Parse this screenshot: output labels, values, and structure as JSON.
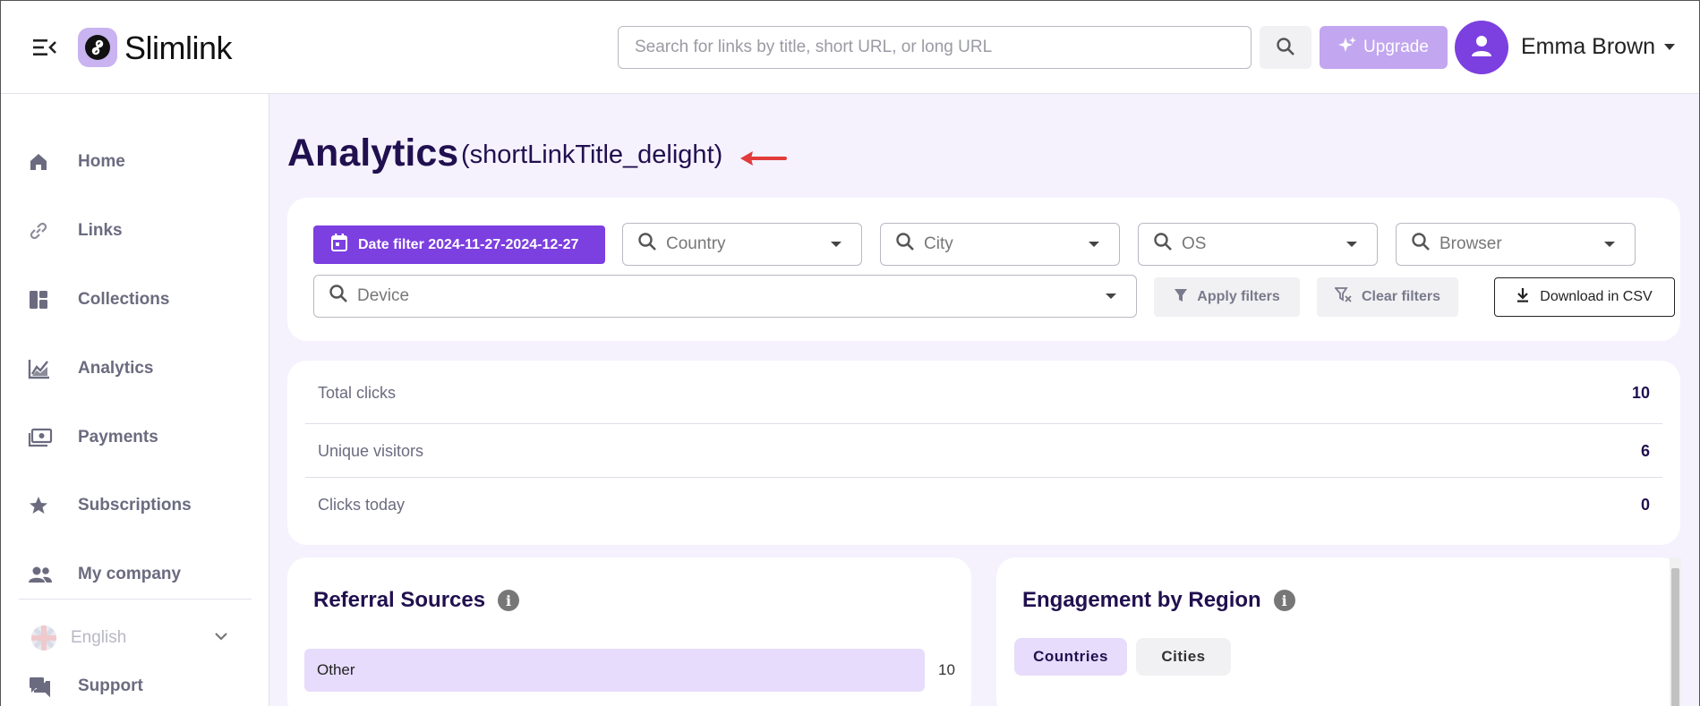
{
  "header": {
    "logo_text": "Slimlink",
    "search_placeholder": "Search for links by title, short URL, or long URL",
    "upgrade_label": "Upgrade",
    "user_name": "Emma Brown"
  },
  "sidebar": {
    "items": [
      {
        "label": "Home",
        "icon": "home-icon"
      },
      {
        "label": "Links",
        "icon": "link-icon"
      },
      {
        "label": "Collections",
        "icon": "collections-icon"
      },
      {
        "label": "Analytics",
        "icon": "analytics-icon"
      },
      {
        "label": "Payments",
        "icon": "payments-icon"
      },
      {
        "label": "Subscriptions",
        "icon": "star-icon"
      },
      {
        "label": "My company",
        "icon": "people-icon"
      },
      {
        "label": "Support",
        "icon": "chat-icon"
      }
    ],
    "language": "English"
  },
  "main": {
    "title": "Analytics",
    "subtitle": "(shortLinkTitle_delight)",
    "filters": {
      "date_label": "Date filter 2024-11-27-2024-12-27",
      "country": "Country",
      "city": "City",
      "os": "OS",
      "browser": "Browser",
      "device": "Device",
      "apply": "Apply filters",
      "clear": "Clear filters",
      "download": "Download in CSV"
    },
    "stats": [
      {
        "name": "Total clicks",
        "value": "10"
      },
      {
        "name": "Unique visitors",
        "value": "6"
      },
      {
        "name": "Clicks today",
        "value": "0"
      }
    ],
    "referral": {
      "title": "Referral Sources",
      "rows": [
        {
          "label": "Other",
          "count": "10"
        }
      ]
    },
    "engagement": {
      "title": "Engagement by Region",
      "tabs": [
        "Countries",
        "Cities"
      ],
      "active_tab": "Countries"
    }
  },
  "colors": {
    "accent": "#7c3fe0",
    "accent_light": "#e7dcfb",
    "upgrade_bg": "#c2a6f0",
    "main_bg": "#f5f2fd",
    "title_color": "#21104f"
  }
}
